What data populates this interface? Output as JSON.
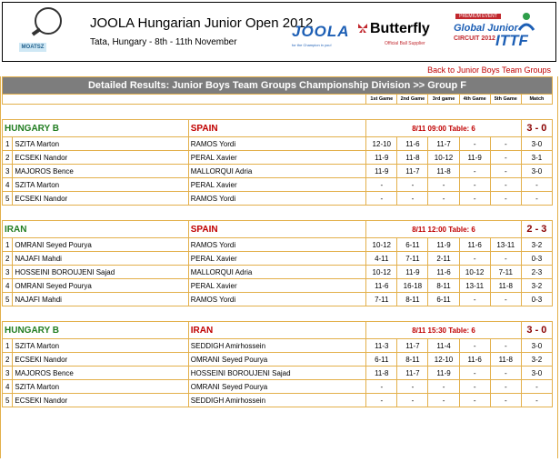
{
  "header": {
    "event_title": "JOOLA Hungarian Junior Open 2012",
    "event_subtitle": "Tata, Hungary - 8th - 11th November",
    "logo_text": "MOATSZ",
    "sponsor1": "JOOLA",
    "sponsor1_tag": "for the Champion in you!",
    "sponsor2": "Butterfly",
    "sponsor2_tag": "Official Ball Supplier",
    "ittf_premium": "PREMIUM EVENT",
    "ittf_line1": "Global Junior",
    "ittf_line2": "CIRCUIT 2012",
    "ittf_mark": "ITTF"
  },
  "back_link": "Back to Junior Boys Team Groups",
  "table_title": "Detailed Results: Junior Boys Team Groups Championship Division   >> Group F",
  "columns": [
    "1st Game",
    "2nd Game",
    "3rd game",
    "4th Game",
    "5th Game",
    "Match"
  ],
  "matches": [
    {
      "teamA": "HUNGARY B",
      "teamB": "SPAIN",
      "info": "8/11 09:00 Table: 6",
      "score": "3 - 0",
      "rows": [
        {
          "n": "1",
          "a": "SZITA Marton",
          "b": "RAMOS Yordi",
          "g": [
            "12-10",
            "11-6",
            "11-7",
            "-",
            "-"
          ],
          "m": "3-0"
        },
        {
          "n": "2",
          "a": "ECSEKI Nandor",
          "b": "PERAL Xavier",
          "g": [
            "11-9",
            "11-8",
            "10-12",
            "11-9",
            "-"
          ],
          "m": "3-1"
        },
        {
          "n": "3",
          "a": "MAJOROS Bence",
          "b": "MALLORQUI Adria",
          "g": [
            "11-9",
            "11-7",
            "11-8",
            "-",
            "-"
          ],
          "m": "3-0"
        },
        {
          "n": "4",
          "a": "SZITA Marton",
          "b": "PERAL Xavier",
          "g": [
            "-",
            "-",
            "-",
            "-",
            "-"
          ],
          "m": "-"
        },
        {
          "n": "5",
          "a": "ECSEKI Nandor",
          "b": "RAMOS Yordi",
          "g": [
            "-",
            "-",
            "-",
            "-",
            "-"
          ],
          "m": "-"
        }
      ]
    },
    {
      "teamA": "IRAN",
      "teamB": "SPAIN",
      "info": "8/11 12:00 Table: 6",
      "score": "2 - 3",
      "rows": [
        {
          "n": "1",
          "a": "OMRANI Seyed Pourya",
          "b": "RAMOS Yordi",
          "g": [
            "10-12",
            "6-11",
            "11-9",
            "11-6",
            "13-11"
          ],
          "m": "3-2"
        },
        {
          "n": "2",
          "a": "NAJAFI Mahdi",
          "b": "PERAL Xavier",
          "g": [
            "4-11",
            "7-11",
            "2-11",
            "-",
            "-"
          ],
          "m": "0-3"
        },
        {
          "n": "3",
          "a": "HOSSEINI BOROUJENI Sajad",
          "b": "MALLORQUI Adria",
          "g": [
            "10-12",
            "11-9",
            "11-6",
            "10-12",
            "7-11"
          ],
          "m": "2-3"
        },
        {
          "n": "4",
          "a": "OMRANI Seyed Pourya",
          "b": "PERAL Xavier",
          "g": [
            "11-6",
            "16-18",
            "8-11",
            "13-11",
            "11-8"
          ],
          "m": "3-2"
        },
        {
          "n": "5",
          "a": "NAJAFI Mahdi",
          "b": "RAMOS Yordi",
          "g": [
            "7-11",
            "8-11",
            "6-11",
            "-",
            "-"
          ],
          "m": "0-3"
        }
      ]
    },
    {
      "teamA": "HUNGARY B",
      "teamB": "IRAN",
      "info": "8/11 15:30 Table: 6",
      "score": "3 - 0",
      "rows": [
        {
          "n": "1",
          "a": "SZITA Marton",
          "b": "SEDDIGH Amirhossein",
          "g": [
            "11-3",
            "11-7",
            "11-4",
            "-",
            "-"
          ],
          "m": "3-0"
        },
        {
          "n": "2",
          "a": "ECSEKI Nandor",
          "b": "OMRANI Seyed Pourya",
          "g": [
            "6-11",
            "8-11",
            "12-10",
            "11-6",
            "11-8"
          ],
          "m": "3-2"
        },
        {
          "n": "3",
          "a": "MAJOROS Bence",
          "b": "HOSSEINI BOROUJENI Sajad",
          "g": [
            "11-8",
            "11-7",
            "11-9",
            "-",
            "-"
          ],
          "m": "3-0"
        },
        {
          "n": "4",
          "a": "SZITA Marton",
          "b": "OMRANI Seyed Pourya",
          "g": [
            "-",
            "-",
            "-",
            "-",
            "-"
          ],
          "m": "-"
        },
        {
          "n": "5",
          "a": "ECSEKI Nandor",
          "b": "SEDDIGH Amirhossein",
          "g": [
            "-",
            "-",
            "-",
            "-",
            "-"
          ],
          "m": "-"
        }
      ]
    }
  ],
  "colors": {
    "accent_border": "#e3b04b",
    "team_a": "#217d21",
    "team_b": "#c00000",
    "title_bar": "#7d7d7d"
  }
}
